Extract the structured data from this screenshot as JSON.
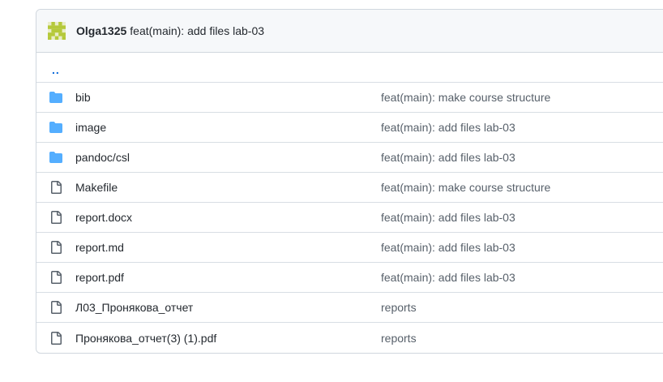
{
  "commit": {
    "author": "Olga1325",
    "message": "feat(main): add files lab-03"
  },
  "parent_link": "..",
  "colors": {
    "folder": "#54aeff",
    "link": "#0969da",
    "avatar": "#b5c93a",
    "muted_text": "#57606a"
  },
  "files": [
    {
      "type": "folder",
      "icon": "folder-icon",
      "name": "bib",
      "commit_message": "feat(main): make course structure"
    },
    {
      "type": "folder",
      "icon": "folder-icon",
      "name": "image",
      "commit_message": "feat(main): add files lab-03"
    },
    {
      "type": "folder",
      "icon": "folder-icon",
      "name": "pandoc/csl",
      "commit_message": "feat(main): add files lab-03"
    },
    {
      "type": "file",
      "icon": "file-icon",
      "name": "Makefile",
      "commit_message": "feat(main): make course structure"
    },
    {
      "type": "file",
      "icon": "file-icon",
      "name": "report.docx",
      "commit_message": "feat(main): add files lab-03"
    },
    {
      "type": "file",
      "icon": "file-icon",
      "name": "report.md",
      "commit_message": "feat(main): add files lab-03"
    },
    {
      "type": "file",
      "icon": "file-icon",
      "name": "report.pdf",
      "commit_message": "feat(main): add files lab-03"
    },
    {
      "type": "file",
      "icon": "file-icon",
      "name": "Л03_Пронякова_отчет",
      "commit_message": "reports"
    },
    {
      "type": "file",
      "icon": "file-icon",
      "name": "Пронякова_отчет(3) (1).pdf",
      "commit_message": "reports"
    }
  ]
}
